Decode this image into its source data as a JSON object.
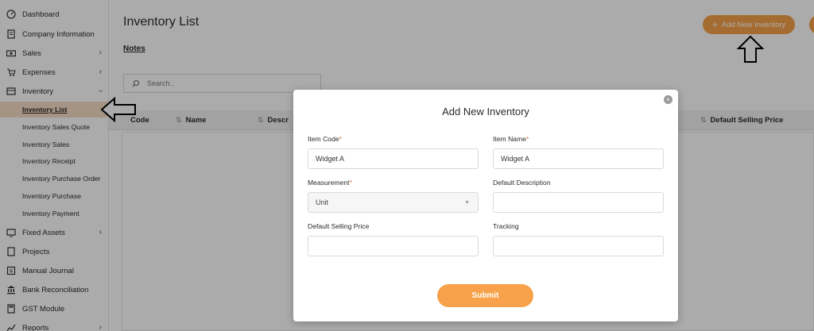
{
  "sidebar": {
    "items": [
      {
        "label": "Dashboard",
        "icon": "dashboard-icon"
      },
      {
        "label": "Company Information",
        "icon": "document-icon"
      },
      {
        "label": "Sales",
        "icon": "money-icon"
      },
      {
        "label": "Expenses",
        "icon": "cart-icon"
      },
      {
        "label": "Inventory",
        "icon": "inventory-icon"
      },
      {
        "label": "Fixed Assets",
        "icon": "assets-icon"
      },
      {
        "label": "Projects",
        "icon": "projects-icon"
      },
      {
        "label": "Manual Journal",
        "icon": "journal-icon"
      },
      {
        "label": "Bank Reconciliation",
        "icon": "bank-icon"
      },
      {
        "label": "GST Module",
        "icon": "calculator-icon"
      },
      {
        "label": "Reports",
        "icon": "chart-icon"
      }
    ],
    "inventory_sub": [
      "Inventory List",
      "Inventory Sales Quote",
      "Inventory Sales",
      "Inventory Receipt",
      "Inventory Purchase Order",
      "Inventory Purchase",
      "Inventory Payment"
    ]
  },
  "main": {
    "title": "Inventory List",
    "notes": "Notes",
    "add_button": "Add New Inventory",
    "search_placeholder": "Search..",
    "columns": [
      "Code",
      "Name",
      "Descr",
      "Default Selling Price"
    ]
  },
  "modal": {
    "title": "Add New Inventory",
    "item_code_label": "Item Code",
    "item_code_value": "Widget A",
    "item_name_label": "Item Name",
    "item_name_value": "Widget A",
    "measurement_label": "Measurement",
    "measurement_value": "Unit",
    "default_description_label": "Default Description",
    "default_selling_price_label": "Default Selling Price",
    "tracking_label": "Tracking",
    "required_mark": "*",
    "submit_label": "Submit"
  },
  "colors": {
    "accent": "#f7a24a",
    "active_bg": "#f7dcc3",
    "required": "#e06a4a"
  }
}
